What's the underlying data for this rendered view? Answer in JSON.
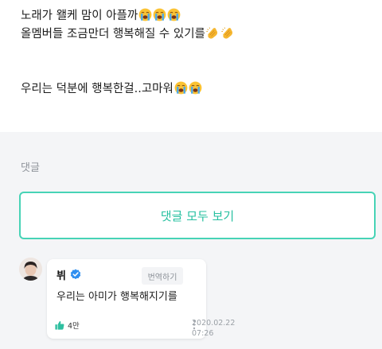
{
  "post": {
    "line1": "노래가 왤케 맘이 아플까",
    "line2": "올멤버들 조금만더 행복해질 수 있기를",
    "line3": "우리는 덕분에 행복한걸..고마워"
  },
  "comments_section": {
    "label": "댓글",
    "view_all_label": "댓글 모두 보기"
  },
  "comment": {
    "author": "뷔",
    "translate_label": "번역하기",
    "text": "우리는 아미가 행복해지기를",
    "like_count": "4만",
    "date": "2020.02.22",
    "time": "07:26"
  },
  "colors": {
    "accent": "#47d3b6",
    "accent_text": "#27c0a0",
    "verified": "#2f8ff0",
    "like": "#2fbfa0"
  },
  "icons": {
    "emoji_cry": "loudly-crying-face-emoji",
    "emoji_clap": "clapping-hands-emoji",
    "verified": "verified-badge-icon",
    "like": "thumbs-up-icon",
    "more": "vertical-dots-icon"
  }
}
